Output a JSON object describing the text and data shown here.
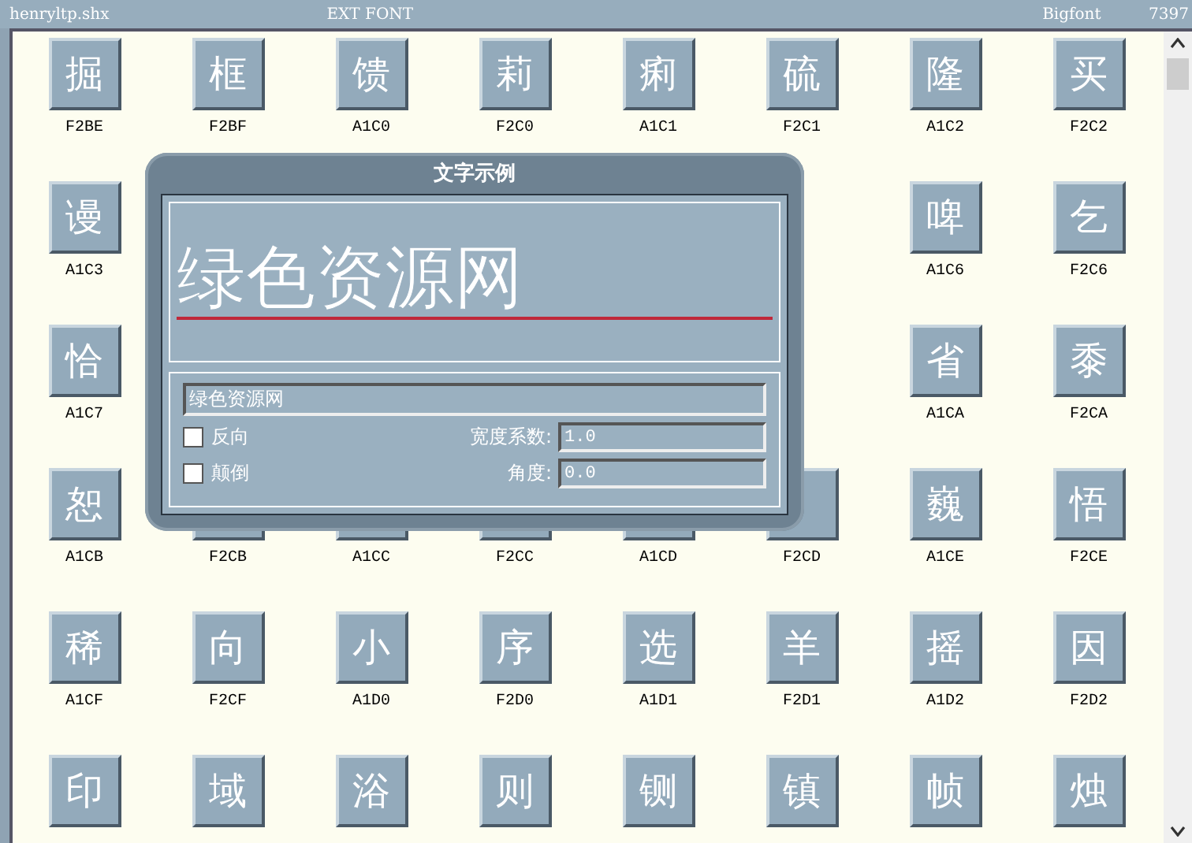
{
  "header": {
    "file": "henryltp.shx",
    "font_type": "EXT FONT",
    "font_kind": "Bigfont",
    "count": "7397"
  },
  "grid": [
    [
      {
        "glyph": "掘",
        "code": "F2BE"
      },
      {
        "glyph": "框",
        "code": "F2BF"
      },
      {
        "glyph": "馈",
        "code": "A1C0"
      },
      {
        "glyph": "莉",
        "code": "F2C0"
      },
      {
        "glyph": "痢",
        "code": "A1C1"
      },
      {
        "glyph": "硫",
        "code": "F2C1"
      },
      {
        "glyph": "隆",
        "code": "A1C2"
      },
      {
        "glyph": "买",
        "code": "F2C2"
      }
    ],
    [
      {
        "glyph": "谩",
        "code": "A1C3"
      },
      {
        "glyph": "啤",
        "code": "A1C6"
      },
      {
        "glyph": "乞",
        "code": "F2C6"
      }
    ],
    [
      {
        "glyph": "恰",
        "code": "A1C7"
      },
      {
        "glyph": "省",
        "code": "A1CA"
      },
      {
        "glyph": "黍",
        "code": "F2CA"
      }
    ],
    [
      {
        "glyph": "恕",
        "code": "A1CB"
      },
      {
        "code": "F2CB"
      },
      {
        "code": "A1CC"
      },
      {
        "code": "F2CC"
      },
      {
        "code": "A1CD"
      },
      {
        "code": "F2CD"
      },
      {
        "glyph": "巍",
        "code": "A1CE"
      },
      {
        "glyph": "悟",
        "code": "F2CE"
      }
    ],
    [
      {
        "glyph": "稀",
        "code": "A1CF"
      },
      {
        "glyph": "向",
        "code": "F2CF"
      },
      {
        "glyph": "小",
        "code": "A1D0"
      },
      {
        "glyph": "序",
        "code": "F2D0"
      },
      {
        "glyph": "选",
        "code": "A1D1"
      },
      {
        "glyph": "羊",
        "code": "F2D1"
      },
      {
        "glyph": "摇",
        "code": "A1D2"
      },
      {
        "glyph": "因",
        "code": "F2D2"
      }
    ],
    [
      {
        "glyph": "印"
      },
      {
        "glyph": "域"
      },
      {
        "glyph": "浴"
      },
      {
        "glyph": "则"
      },
      {
        "glyph": "铡"
      },
      {
        "glyph": "镇"
      },
      {
        "glyph": "帧"
      },
      {
        "glyph": "烛"
      }
    ]
  ],
  "dialog": {
    "title": "文字示例",
    "preview": "绿色资源网",
    "text_value": "绿色资源网",
    "options": [
      {
        "label": "反向",
        "checked": false
      },
      {
        "label": "颠倒",
        "checked": false
      }
    ],
    "fields": [
      {
        "label": "宽度系数:",
        "value": "1.0"
      },
      {
        "label": "角度:",
        "value": "0.0"
      }
    ]
  }
}
